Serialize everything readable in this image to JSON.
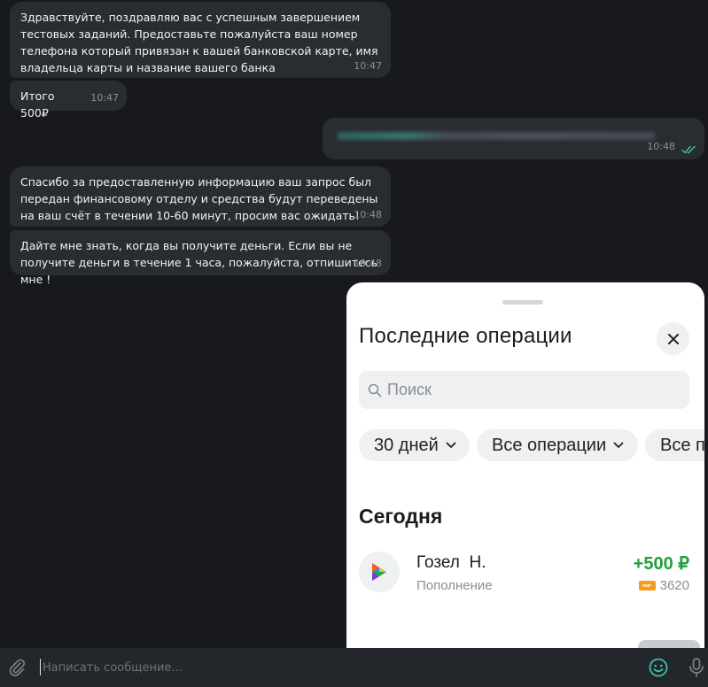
{
  "messages": [
    {
      "text": "Здравствуйте, поздравляю вас с успешным завершением тестовых заданий. Предоставьте пожалуйста ваш номер телефона который привязан к вашей банковской карте, имя владельца карты и название вашего банка",
      "time": "10:47"
    },
    {
      "text": "Итого 500₽",
      "time": "10:47"
    },
    {
      "text": "",
      "time": "10:48",
      "outgoing": true,
      "status": "read"
    },
    {
      "text": "Спасибо за предоставленную информацию ваш запрос был передан финансовому отделу и средства будут переведены на ваш счёт в течении 10-60 минут, просим вас ожидать!",
      "time": "10:48"
    },
    {
      "text": "Дайте мне знать, когда вы получите деньги. Если вы не получите деньги в течение 1 часа, пожалуйста, отпишитесь мне !",
      "time": "10:48"
    }
  ],
  "bank_screenshot": {
    "title": "Последние операции",
    "search_placeholder": "Поиск",
    "filters": [
      "30 дней",
      "Все операции",
      "Все п"
    ],
    "section": "Сегодня",
    "operation": {
      "name": "Гозел  Н.",
      "type": "Пополнение",
      "amount": "+500 ₽",
      "card_label": "МИР",
      "card_last4": "3620"
    }
  },
  "composer": {
    "placeholder": "Написать сообщение..."
  },
  "colors": {
    "background": "#17191d",
    "bubble": "#292c31",
    "read_check": "#3fc0a8",
    "positive_amount": "#21a038",
    "emoji_accent": "#3fc0a8"
  },
  "icons": [
    "paperclip-icon",
    "double-check-icon",
    "close-icon",
    "search-icon",
    "chevron-down-icon",
    "bank-logo-icon",
    "smile-icon",
    "microphone-icon"
  ]
}
